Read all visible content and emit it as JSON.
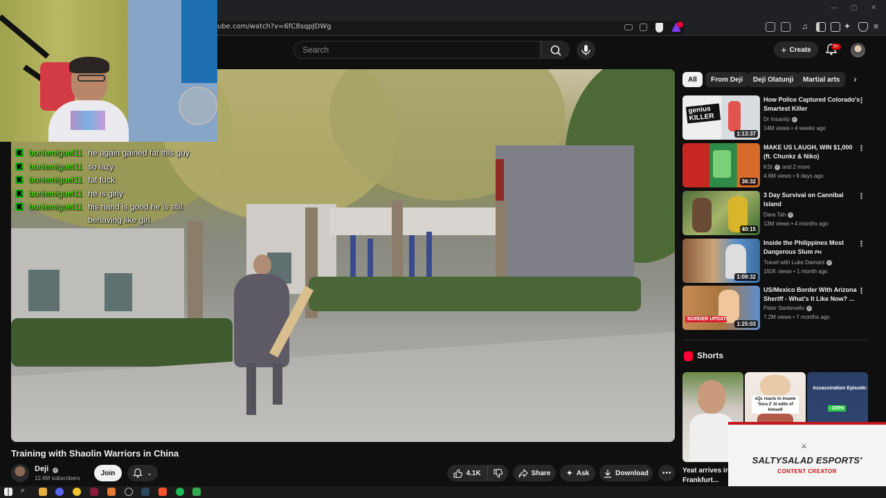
{
  "browser": {
    "url": "ube.com/watch?v=6fC8sqpJDWg",
    "window_controls": [
      "—",
      "▢",
      "✕"
    ]
  },
  "masthead": {
    "search_placeholder": "Search",
    "create_label": "Create",
    "notif_badge": "9+"
  },
  "chat": [
    {
      "user": "boniemiguel11",
      "text": "he again gained fat this guy"
    },
    {
      "user": "boniemiguel11",
      "text": "so lazy"
    },
    {
      "user": "boniemiguel11",
      "text": "fat fuck"
    },
    {
      "user": "boniemiguel11",
      "text": "he is girly"
    },
    {
      "user": "boniemiguel11",
      "text": "his hand is good he is still behaving like girl"
    }
  ],
  "video": {
    "title": "Training with Shaolin Warriors in China",
    "channel": "Deji",
    "subscribers": "12.6M subscribers",
    "join_label": "Join",
    "likes": "4.1K",
    "share_label": "Share",
    "ask_label": "Ask",
    "download_label": "Download"
  },
  "chips": [
    "All",
    "From Deji",
    "Deji Olatunji",
    "Martial arts"
  ],
  "recommendations": [
    {
      "title": "How Police Captured Colorado's Smartest Killer",
      "channel": "Dr Insanity",
      "verified": true,
      "extra": "",
      "meta": "14M views • 4 weeks ago",
      "duration": "1:13:37",
      "thumb_text": "genius KILLER"
    },
    {
      "title": "MAKE US LAUGH, WIN $1,000 (ft. Chunkz & Niko)",
      "channel": "KSI",
      "verified": true,
      "extra": "and 2 more",
      "meta": "4.6M views • 9 days ago",
      "duration": "36:32",
      "thumb_text": ""
    },
    {
      "title": "3 Day Survival on Cannibal Island",
      "channel": "Dara Tah",
      "verified": true,
      "extra": "",
      "meta": "13M views • 4 months ago",
      "duration": "40:15",
      "thumb_text": ""
    },
    {
      "title": "Inside the Philippines Most Dangerous Slum",
      "title_tag": "PH",
      "channel": "Travel with Luke Damant",
      "verified": true,
      "extra": "",
      "meta": "192K views • 1 month ago",
      "duration": "1:09:32",
      "thumb_text": ""
    },
    {
      "title": "US/Mexico Border With Arizona Sheriff - What's It Like Now? ...",
      "channel": "Peter Santenello",
      "verified": true,
      "extra": "",
      "meta": "7.2M views • 7 months ago",
      "duration": "1:25:03",
      "thumb_text": "BORDER UPDATE"
    }
  ],
  "shorts": {
    "heading": "Shorts",
    "items": [
      {
        "title": "Yeat arrives in Frankfurt...",
        "thumb_text": ""
      },
      {
        "title": "",
        "thumb_text": "xQc reacts to insane 'Sora 2' AI edits of himself"
      },
      {
        "title": "",
        "thumb_text": "Assassination Episode:",
        "badge": "-100%"
      }
    ]
  },
  "overlay": {
    "brand": "SALTYSALAD ESPORTS'",
    "subtitle": "CONTENT CREATOR"
  },
  "colors": {
    "kick_green": "#53fc18",
    "yt_red": "#ff0033",
    "overlay_red": "#c5141b"
  }
}
